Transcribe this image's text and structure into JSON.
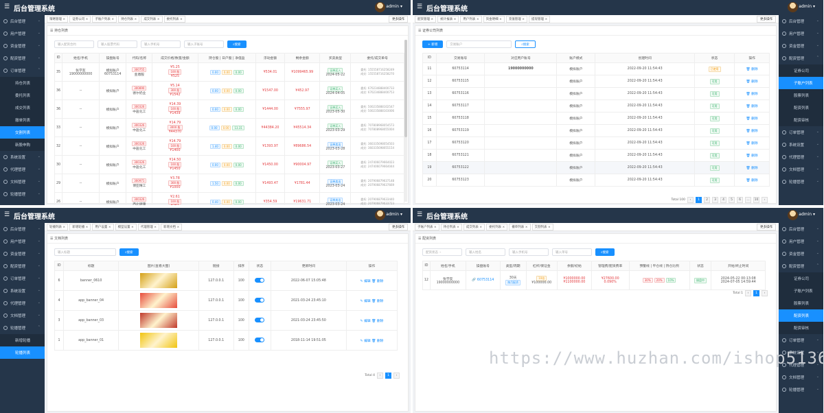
{
  "app_title": "后台管理系统",
  "username": "admin",
  "more_ops": "更多操作",
  "sidebar_common": {
    "dashboard": "后台管理",
    "users": "用户管理",
    "funds": "资金管理",
    "config": "配资管理",
    "orders": "订单管理",
    "system": "系统设置",
    "agent": "代理管理",
    "doc": "文档管理",
    "carousel": "轮播管理"
  },
  "panel1": {
    "tags": [
      "策略管理",
      "证券公司",
      "子账户列表",
      "持仓列表",
      "成交列表",
      "委托列表"
    ],
    "sub_items": [
      "持仓列表",
      "委托列表",
      "成交列表",
      "撤单列表",
      "交割列表",
      "新股申购"
    ],
    "card_title": "持仓列表",
    "filters": [
      "输入配资合约",
      "输入股票代码",
      "输入手机号",
      "输入子账号"
    ],
    "search": "搜索",
    "headers": [
      "ID",
      "姓名/手机",
      "操盘账号",
      "代码/名称",
      "成交价格/数量/金额",
      "持仓股 | 日户股 | 净值盈",
      "浮动金额",
      "剩余金额",
      "买卖类型",
      "委托/成交单号"
    ],
    "rows": [
      {
        "id": "35",
        "name": "张学友\n19000000000",
        "acct": "模拟账户\n60753114",
        "code": "300755",
        "stock": "金盾股",
        "p1": "¥5.25",
        "p2": "100 股",
        "p3": "¥525",
        "b1": "0.00",
        "b2": "0.00",
        "b3": "0.00",
        "float": "¥534.01",
        "rem": "¥1099465.99",
        "type": "证券买入",
        "date": "2024-05-22",
        "o1": "委托: 155558716258249",
        "o2": "成交: 155558716258270"
      },
      {
        "id": "36",
        "name": "--",
        "acct": "模拟账户",
        "code": "300890",
        "stock": "德尔奶业",
        "p1": "¥5.14",
        "p2": "300 股",
        "p3": "¥1542",
        "b1": "0.00",
        "b2": "0.00",
        "b3": "0.00",
        "float": "¥1547.00",
        "rem": "¥452.97",
        "type": "证券买入",
        "date": "2024-04-05",
        "o1": "委托: 670234888400733",
        "o2": "成交: 670234888400753"
      },
      {
        "id": "36",
        "name": "--",
        "acct": "模拟账户",
        "code": "300326",
        "stock": "中盐化工",
        "p1": "¥14.39",
        "p2": "100 股",
        "p3": "¥1439",
        "b1": "0.00",
        "b2": "0.00",
        "b3": "0.00",
        "float": "¥1444.00",
        "rem": "¥7555.97",
        "type": "证券买入",
        "date": "2023-05-30",
        "o1": "委托: 500235888102547",
        "o2": "成交: 500235888103006"
      },
      {
        "id": "33",
        "name": "--",
        "acct": "模拟账户",
        "code": "300326",
        "stock": "中盐化工",
        "p1": "¥14.79",
        "p2": "3000 股",
        "p3": "¥44370",
        "b1": "0.00",
        "b2": "0.00",
        "b3": "13.31",
        "float": "¥44384.20",
        "rem": "¥45514.34",
        "type": "证券买入",
        "date": "2023-03-29",
        "o1": "委托: 707808968054573",
        "o2": "成交: 707808968055004"
      },
      {
        "id": "32",
        "name": "--",
        "acct": "模拟账户",
        "code": "300326",
        "stock": "中盐化工",
        "p1": "¥14.79",
        "p2": "100 股",
        "p3": "¥1400",
        "b1": "1.40",
        "b2": "0.00",
        "b3": "0.00",
        "float": "¥1393.97",
        "rem": "¥89686.54",
        "type": "证券卖出",
        "date": "2023-03-28",
        "o1": "委托: 360335698054503",
        "o2": "成交: 360335698055154"
      },
      {
        "id": "30",
        "name": "--",
        "acct": "模拟账户",
        "code": "300326",
        "stock": "中盐化工",
        "p1": "¥14.50",
        "p2": "100 股",
        "p3": "¥1450",
        "b1": "0.00",
        "b2": "0.00",
        "b3": "0.00",
        "float": "¥1450.00",
        "rem": "¥90004.97",
        "type": "证券买入",
        "date": "2023-03-27",
        "o1": "委托: 247406079664023",
        "o2": "成交: 247406079664044"
      },
      {
        "id": "29",
        "name": "--",
        "acct": "模拟账户",
        "code": "300971",
        "stock": "博亚精工",
        "p1": "¥3.78",
        "p2": "300 股",
        "p3": "¥1000",
        "b1": "1.50",
        "b2": "0.00",
        "b3": "0.00",
        "float": "¥1493.47",
        "rem": "¥1781.44",
        "type": "证券卖出",
        "date": "2023-03-24",
        "o1": "委托: 207906879637148",
        "o2": "成交: 207906879637669"
      },
      {
        "id": "26",
        "name": "--",
        "acct": "模拟账户",
        "code": "300326",
        "stock": "西北健康",
        "p1": "¥2.61",
        "p2": "100 股",
        "p3": "¥261",
        "b1": "0.40",
        "b2": "0.00",
        "b3": "0.00",
        "float": "¥354.59",
        "rem": "¥19631.71",
        "type": "证券卖出",
        "date": "2023-03-24",
        "o1": "委托: 207906879633440",
        "o2": "成交: 207906879633723"
      }
    ]
  },
  "panel2": {
    "tags": [
      "配资管理",
      "统计报表",
      "用户列表",
      "资金明细",
      "充值管理",
      "提现管理"
    ],
    "sub_items": [
      "证券公司",
      "子账户列表",
      "股票列表",
      "配资列表",
      "配资审核"
    ],
    "card_title": "证券公司列表",
    "add": "+ 新增",
    "filter": "交易账户",
    "search": "搜索",
    "headers": [
      "ID",
      "交易账号",
      "对应用户账号",
      "账户模式",
      "创建时间",
      "状态",
      "操作"
    ],
    "rows": [
      {
        "id": "11",
        "acct": "60753114",
        "user": "19000000000",
        "mode": "模拟账户",
        "time": "2022-09-20 11:54:43",
        "status": "已使用",
        "st": "used"
      },
      {
        "id": "12",
        "acct": "60753115",
        "user": "",
        "mode": "模拟账户",
        "time": "2022-09-20 11:54:43",
        "status": "可用",
        "st": "ok"
      },
      {
        "id": "13",
        "acct": "60753116",
        "user": "",
        "mode": "模拟账户",
        "time": "2022-09-20 11:54:43",
        "status": "可用",
        "st": "ok"
      },
      {
        "id": "14",
        "acct": "60753117",
        "user": "",
        "mode": "模拟账户",
        "time": "2022-09-20 11:54:43",
        "status": "可用",
        "st": "ok"
      },
      {
        "id": "15",
        "acct": "60753118",
        "user": "",
        "mode": "模拟账户",
        "time": "2022-09-20 11:54:43",
        "status": "可用",
        "st": "ok"
      },
      {
        "id": "16",
        "acct": "60753119",
        "user": "",
        "mode": "模拟账户",
        "time": "2022-09-20 11:54:43",
        "status": "可用",
        "st": "ok"
      },
      {
        "id": "17",
        "acct": "60753120",
        "user": "",
        "mode": "模拟账户",
        "time": "2022-09-20 11:54:43",
        "status": "可用",
        "st": "ok"
      },
      {
        "id": "18",
        "acct": "60753121",
        "user": "",
        "mode": "模拟账户",
        "time": "2022-09-20 11:54:43",
        "status": "可用",
        "st": "ok"
      },
      {
        "id": "19",
        "acct": "60753122",
        "user": "",
        "mode": "模拟账户",
        "time": "2022-09-20 11:54:43",
        "status": "可用",
        "st": "ok"
      },
      {
        "id": "20",
        "acct": "60753123",
        "user": "",
        "mode": "模拟账户",
        "time": "2022-09-20 11:54:43",
        "status": "可用",
        "st": "ok"
      }
    ],
    "delete": "删除",
    "total": "Total 100",
    "pages": [
      "1",
      "2",
      "3",
      "4",
      "5",
      "6",
      "...",
      "10"
    ]
  },
  "panel3": {
    "tags": [
      "轮播列表",
      "新增轮播",
      "用户设置",
      "模型设置",
      "代理管理",
      "新增文档"
    ],
    "sub_items": [
      "新增轮播",
      "轮播列表"
    ],
    "card_title": "文档列表",
    "filter": "输入标题",
    "search": "搜索",
    "headers": [
      "ID",
      "标题",
      "图片(查看大图)",
      "链接",
      "排序",
      "状态",
      "更新时间",
      "操作"
    ],
    "rows": [
      {
        "id": "6",
        "title": "banner_0610",
        "link": "127.0.0.1",
        "sort": "100",
        "time": "2022-06-07 15:05:48",
        "color": "#d4a017"
      },
      {
        "id": "4",
        "title": "app_banner_04",
        "link": "127.0.0.1",
        "sort": "100",
        "time": "2021-03-24 23:45:10",
        "color": "#e74c3c"
      },
      {
        "id": "3",
        "title": "app_banner_03",
        "link": "127.0.0.1",
        "sort": "100",
        "time": "2021-03-24 23:45:50",
        "color": "#c0392b"
      },
      {
        "id": "1",
        "title": "app_banner_01",
        "link": "127.0.0.1",
        "sort": "100",
        "time": "2018-11-14 19:51:05",
        "color": "#f1c40f"
      }
    ],
    "edit": "编辑",
    "delete": "删除",
    "total": "Total 4",
    "pages": [
      "1"
    ]
  },
  "panel4": {
    "tags": [
      "子账户列表",
      "持仓列表",
      "成交列表",
      "委托列表",
      "撤单列表",
      "交割列表"
    ],
    "sub_items": [
      "证券公司",
      "子账户列表",
      "股票列表",
      "配资列表",
      "配资审核"
    ],
    "card_title": "配资列表",
    "filters": [
      "配资状态",
      "输入姓名",
      "输入手机号",
      "输入单号"
    ],
    "search": "搜索",
    "headers": [
      "ID",
      "姓名/手机",
      "操盘账号",
      "类型/周期",
      "杠杆/保证金",
      "余额/初始",
      "管理费/配资费率",
      "预警线 | 平仓线 | 持仓比例",
      "状态",
      "开始/终止时间"
    ],
    "row": {
      "id": "12",
      "name": "张学友",
      "phone": "19000000000",
      "acct": "60753114",
      "cycle": "30天",
      "type": "按月配资",
      "lev": "10倍",
      "margin": "¥100000.00",
      "bal": "¥1000000.00",
      "init": "¥1100000.00",
      "fee": "¥27600.00",
      "rate": "0.090%",
      "w": "30%",
      "c": "20%",
      "h": "10%",
      "status": "操盘中",
      "start": "2024-05-22 00:13:08",
      "end": "2024-07-05 14:59:44"
    },
    "total": "Total 1",
    "pages": [
      "1"
    ]
  },
  "watermark": "https://www.huzhan.com/ishop51368"
}
